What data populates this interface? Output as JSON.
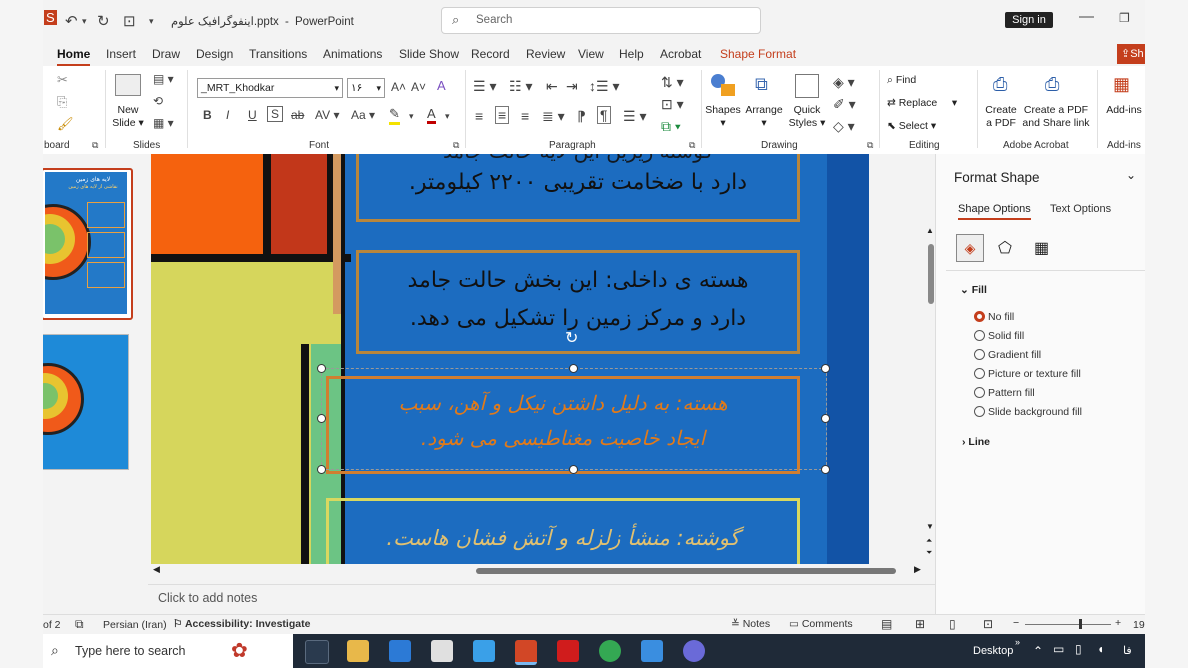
{
  "titlebar": {
    "filename": "اینفوگرافیک علوم.pptx",
    "sep": "-",
    "app": "PowerPoint",
    "search_placeholder": "Search",
    "signin": "Sign in"
  },
  "tabs": [
    "Home",
    "Insert",
    "Draw",
    "Design",
    "Transitions",
    "Animations",
    "Slide Show",
    "Record",
    "Review",
    "View",
    "Help",
    "Acrobat",
    "Shape Format"
  ],
  "share_label": "Sh",
  "ribbon": {
    "clipboard_label": "board",
    "slides": {
      "new_slide": "New",
      "new_slide2": "Slide",
      "label": "Slides"
    },
    "font": {
      "name": "_MRT_Khodkar",
      "size": "۱۶",
      "label": "Font",
      "aa": "Aa"
    },
    "paragraph_label": "Paragraph",
    "drawing": {
      "shapes": "Shapes",
      "arrange": "Arrange",
      "quick": "Quick",
      "styles": "Styles",
      "label": "Drawing"
    },
    "editing": {
      "find": "Find",
      "replace": "Replace",
      "select": "Select",
      "label": "Editing"
    },
    "acrobat": {
      "create1": "Create",
      "create2": "a PDF",
      "share1": "Create a PDF",
      "share2": "and Share link",
      "label": "Adobe Acrobat"
    },
    "addins": {
      "btn": "Add-ins",
      "label": "Add-ins"
    }
  },
  "slide": {
    "box1_line": "دارد با ضخامت تقریبی ۲۲۰۰ کیلومتر.",
    "box1_partial": "گوشته زیرین این لایه حالت جامد",
    "box2_line1": "هسته ی داخلی: این بخش حالت جامد",
    "box2_line2": "دارد و مرکز زمین را تشکیل می دهد.",
    "box3_line1": "هسته: به دلیل داشتن نیکل و آهن، سبب",
    "box3_line2": "ایجاد خاصیت مغناطیسی می شود.",
    "box4_line1": "گوشته: منشأ زلزله و آتش فشان هاست."
  },
  "thumbs": {
    "t1_title": "لایه های زمین",
    "t1_sub": "نقاشی از لایه های زمین"
  },
  "notes_placeholder": "Click to add notes",
  "format_pane": {
    "title": "Format Shape",
    "tab_shape": "Shape Options",
    "tab_text": "Text Options",
    "section_fill": "Fill",
    "options": [
      "No fill",
      "Solid fill",
      "Gradient fill",
      "Picture or texture fill",
      "Pattern fill",
      "Slide background fill"
    ],
    "selected_option": "No fill",
    "section_line": "Line"
  },
  "status": {
    "slide_of": "of 2",
    "language": "Persian (Iran)",
    "accessibility": "Accessibility: Investigate",
    "notes": "Notes",
    "comments": "Comments",
    "zoom": "19"
  },
  "taskbar": {
    "search": "Type here to search",
    "desktop": "Desktop",
    "lang": "فا"
  },
  "colors": {
    "accent": "#c43e1c",
    "slide_bg": "#1c6cc0",
    "text_orange": "#e07a1a"
  }
}
